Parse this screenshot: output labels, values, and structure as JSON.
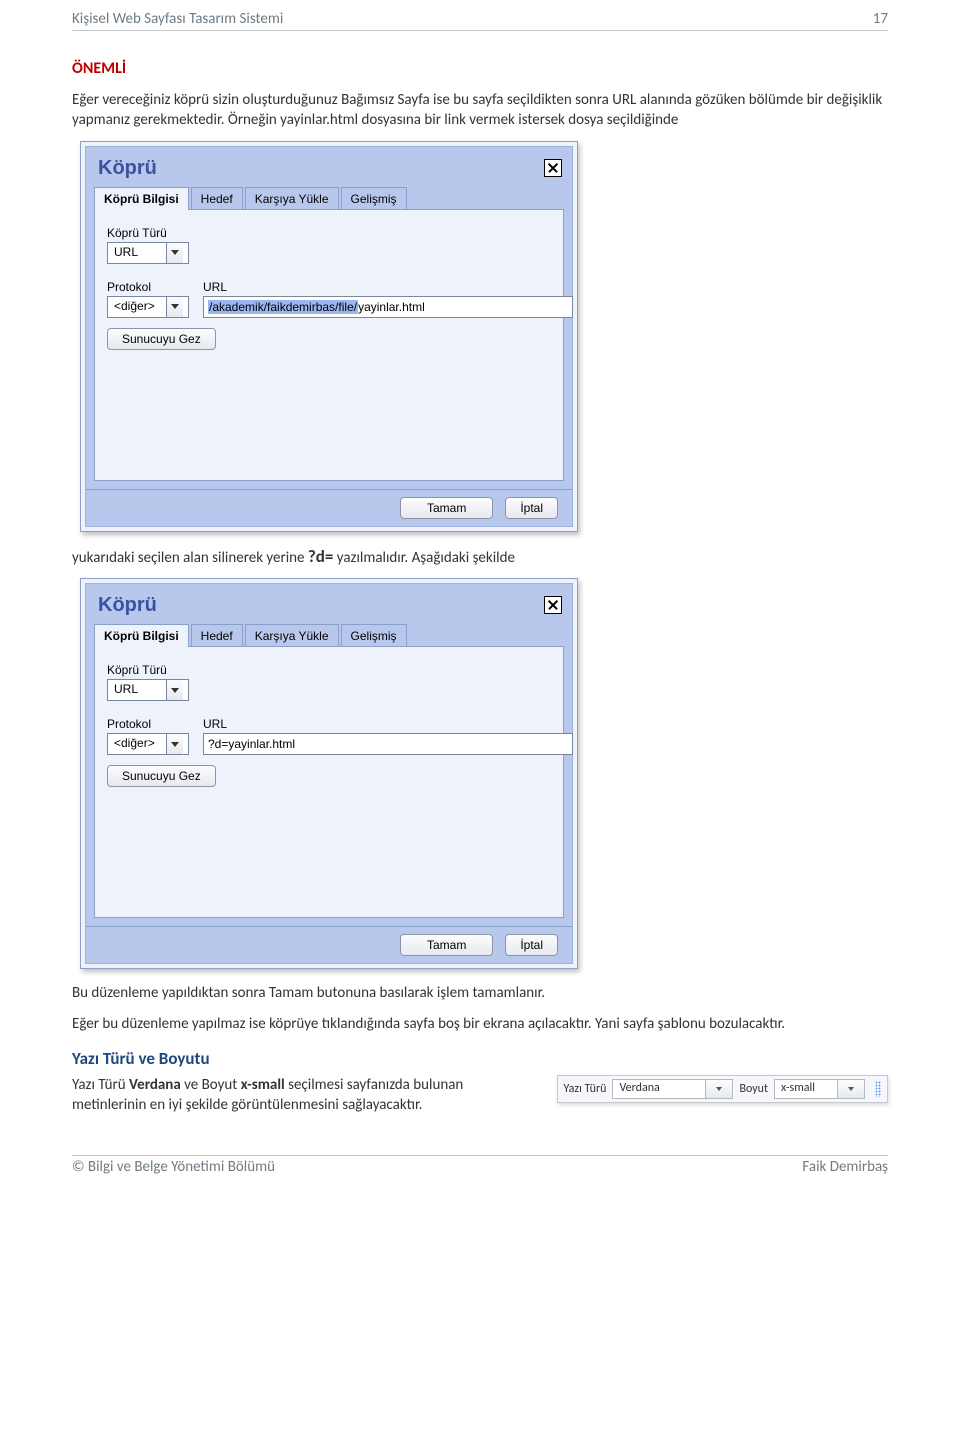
{
  "header": {
    "title": "Kişisel Web Sayfası Tasarım Sistemi",
    "page_number": "17"
  },
  "footer": {
    "left": "© Bilgi ve Belge Yönetimi Bölümü",
    "right": "Faik Demirbaş"
  },
  "section_onemli": "ÖNEMLİ",
  "para_intro": "Eğer vereceğiniz köprü sizin oluşturduğunuz Bağımsız Sayfa ise bu sayfa seçildikten sonra URL alanında gözüken bölümde bir değişiklik yapmanız gerekmektedir. Örneğin yayinlar.html dosyasına bir link vermek istersek dosya seçildiğinde",
  "dialog": {
    "title": "Köprü",
    "tabs": [
      "Köprü Bilgisi",
      "Hedef",
      "Karşıya Yükle",
      "Gelişmiş"
    ],
    "kopru_turu_label": "Köprü Türü",
    "kopru_turu_value": "URL",
    "protokol_label": "Protokol",
    "protokol_value": "<diğer>",
    "url_label": "URL",
    "url1_prefix": "/akademik/faikdemirbas/file/",
    "url1_suffix": "yayinlar.html",
    "url2_value": "?d=yayinlar.html",
    "sunucu_btn": "Sunucuyu Gez",
    "ok_btn": "Tamam",
    "cancel_btn": "İptal"
  },
  "mid_text_pre": "yukarıdaki seçilen alan silinerek yerine ",
  "mid_text_code": "?d=",
  "mid_text_post": " yazılmalıdır. Aşağıdaki şekilde",
  "para_after2": "Bu düzenleme yapıldıktan sonra Tamam butonuna basılarak işlem tamamlanır.",
  "para_warn": "Eğer bu düzenleme yapılmaz ise köprüye tıklandığında sayfa boş bir ekrana açılacaktır. Yani sayfa şablonu bozulacaktır.",
  "yazi_heading": "Yazı Türü ve Boyutu",
  "yazi_para_pre": "Yazı Türü ",
  "yazi_verdana": "Verdana",
  "yazi_mid": " ve Boyut ",
  "yazi_xsmall": "x-small",
  "yazi_post": " seçilmesi sayfanızda bulunan metinlerinin en iyi şekilde görüntülenmesini sağlayacaktır.",
  "toolbar": {
    "font_label": "Yazı Türü",
    "font_value": "Verdana",
    "size_label": "Boyut",
    "size_value": "x-small"
  }
}
